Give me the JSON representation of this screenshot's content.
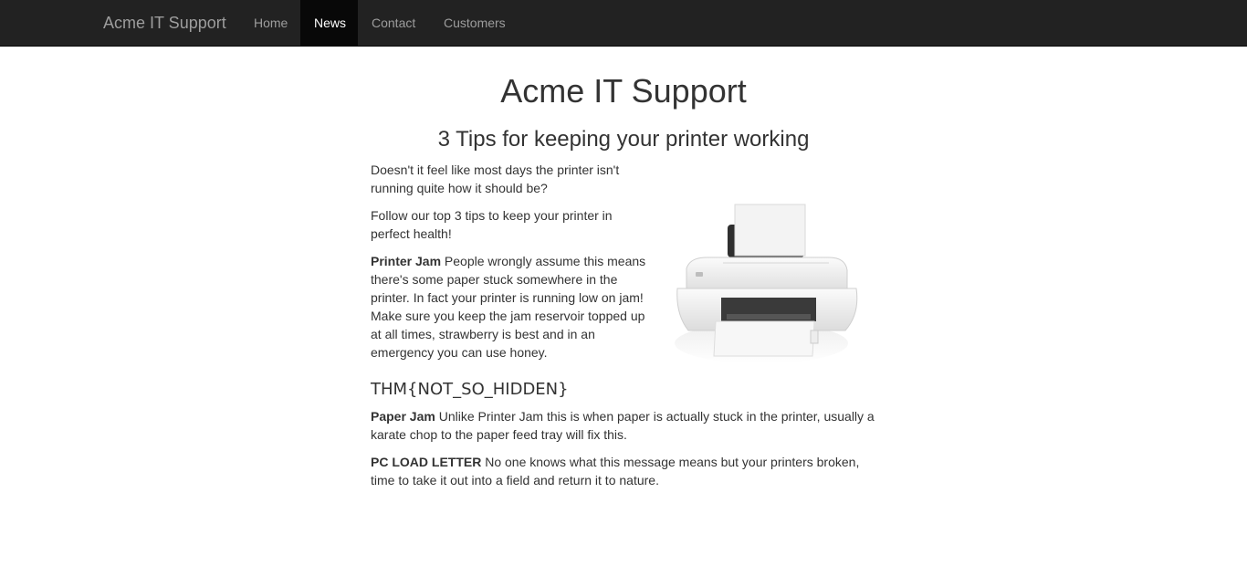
{
  "navbar": {
    "brand": "Acme IT Support",
    "items": [
      {
        "label": "Home",
        "active": false
      },
      {
        "label": "News",
        "active": true
      },
      {
        "label": "Contact",
        "active": false
      },
      {
        "label": "Customers",
        "active": false
      }
    ]
  },
  "main": {
    "title": "Acme IT Support",
    "article": {
      "title": "3 Tips for keeping your printer working",
      "intro1": "Doesn't it feel like most days the printer isn't running quite how it should be?",
      "intro2": "Follow our top 3 tips to keep your printer in perfect health!",
      "tips": [
        {
          "name": "Printer Jam",
          "text": " People wrongly assume this means there's some paper stuck somewhere in the printer. In fact your printer is running low on jam! Make sure you keep the jam reservoir topped up at all times, strawberry is best and in an emergency you can use honey."
        },
        {
          "name": "Paper Jam",
          "text": " Unlike Printer Jam this is when paper is actually stuck in the printer, usually a karate chop to the paper feed tray will fix this."
        },
        {
          "name": "PC LOAD LETTER",
          "text": " No one knows what this message means but your printers broken, time to take it out into a field and return it to nature."
        }
      ],
      "hidden_text": "THM{NOT_SO_HIDDEN}",
      "image_icon": "printer-image"
    }
  },
  "colors": {
    "navbar_bg": "#222222",
    "nav_active_bg": "#080808",
    "nav_text": "#9d9d9d",
    "body_text": "#333333"
  }
}
